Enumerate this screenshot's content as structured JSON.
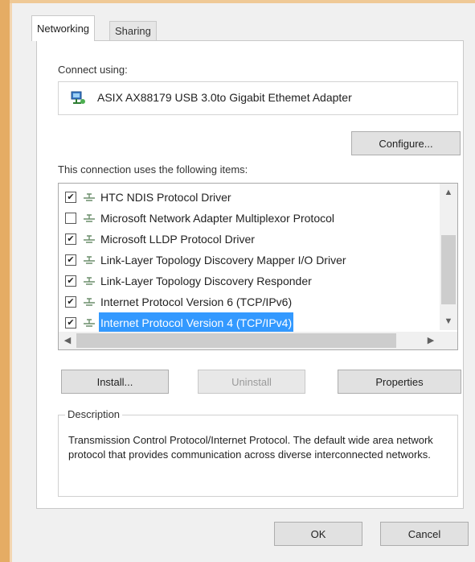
{
  "tabs": [
    {
      "label": "Networking",
      "active": true
    },
    {
      "label": "Sharing",
      "active": false
    }
  ],
  "connect_using_label": "Connect using:",
  "adapter": {
    "name": "ASIX AX88179 USB 3.0to Gigabit Ethemet Adapter",
    "icon": "network-adapter-icon"
  },
  "configure_label": "Configure...",
  "items_label": "This connection uses the following items:",
  "items": [
    {
      "label": "HTC NDIS Protocol Driver",
      "checked": true,
      "selected": false
    },
    {
      "label": "Microsoft Network Adapter Multiplexor Protocol",
      "checked": false,
      "selected": false
    },
    {
      "label": "Microsoft LLDP Protocol Driver",
      "checked": true,
      "selected": false
    },
    {
      "label": "Link-Layer Topology Discovery Mapper I/O Driver",
      "checked": true,
      "selected": false
    },
    {
      "label": "Link-Layer Topology Discovery Responder",
      "checked": true,
      "selected": false
    },
    {
      "label": "Internet Protocol Version 6 (TCP/IPv6)",
      "checked": true,
      "selected": false
    },
    {
      "label": "Internet Protocol Version 4 (TCP/IPv4)",
      "checked": true,
      "selected": true
    }
  ],
  "buttons": {
    "install": "Install...",
    "uninstall": "Uninstall",
    "properties": "Properties"
  },
  "description": {
    "legend": "Description",
    "text": "Transmission Control Protocol/Internet Protocol. The default wide area network protocol that provides communication across diverse interconnected networks."
  },
  "footer": {
    "ok": "OK",
    "cancel": "Cancel"
  },
  "colors": {
    "selection": "#3399ff",
    "frame_accent": "#e5ac64"
  }
}
